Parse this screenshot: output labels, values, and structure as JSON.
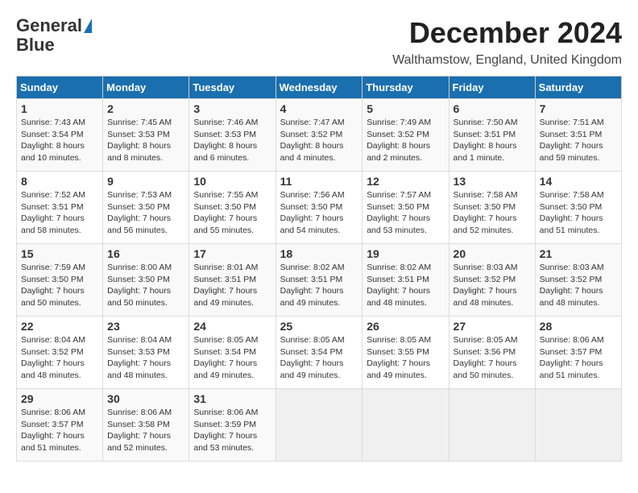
{
  "logo": {
    "line1": "General",
    "line2": "Blue"
  },
  "title": "December 2024",
  "subtitle": "Walthamstow, England, United Kingdom",
  "days_header": [
    "Sunday",
    "Monday",
    "Tuesday",
    "Wednesday",
    "Thursday",
    "Friday",
    "Saturday"
  ],
  "weeks": [
    [
      {
        "day": "1",
        "sunrise": "7:43 AM",
        "sunset": "3:54 PM",
        "daylight": "8 hours and 10 minutes."
      },
      {
        "day": "2",
        "sunrise": "7:45 AM",
        "sunset": "3:53 PM",
        "daylight": "8 hours and 8 minutes."
      },
      {
        "day": "3",
        "sunrise": "7:46 AM",
        "sunset": "3:53 PM",
        "daylight": "8 hours and 6 minutes."
      },
      {
        "day": "4",
        "sunrise": "7:47 AM",
        "sunset": "3:52 PM",
        "daylight": "8 hours and 4 minutes."
      },
      {
        "day": "5",
        "sunrise": "7:49 AM",
        "sunset": "3:52 PM",
        "daylight": "8 hours and 2 minutes."
      },
      {
        "day": "6",
        "sunrise": "7:50 AM",
        "sunset": "3:51 PM",
        "daylight": "8 hours and 1 minute."
      },
      {
        "day": "7",
        "sunrise": "7:51 AM",
        "sunset": "3:51 PM",
        "daylight": "7 hours and 59 minutes."
      }
    ],
    [
      {
        "day": "8",
        "sunrise": "7:52 AM",
        "sunset": "3:51 PM",
        "daylight": "7 hours and 58 minutes."
      },
      {
        "day": "9",
        "sunrise": "7:53 AM",
        "sunset": "3:50 PM",
        "daylight": "7 hours and 56 minutes."
      },
      {
        "day": "10",
        "sunrise": "7:55 AM",
        "sunset": "3:50 PM",
        "daylight": "7 hours and 55 minutes."
      },
      {
        "day": "11",
        "sunrise": "7:56 AM",
        "sunset": "3:50 PM",
        "daylight": "7 hours and 54 minutes."
      },
      {
        "day": "12",
        "sunrise": "7:57 AM",
        "sunset": "3:50 PM",
        "daylight": "7 hours and 53 minutes."
      },
      {
        "day": "13",
        "sunrise": "7:58 AM",
        "sunset": "3:50 PM",
        "daylight": "7 hours and 52 minutes."
      },
      {
        "day": "14",
        "sunrise": "7:58 AM",
        "sunset": "3:50 PM",
        "daylight": "7 hours and 51 minutes."
      }
    ],
    [
      {
        "day": "15",
        "sunrise": "7:59 AM",
        "sunset": "3:50 PM",
        "daylight": "7 hours and 50 minutes."
      },
      {
        "day": "16",
        "sunrise": "8:00 AM",
        "sunset": "3:50 PM",
        "daylight": "7 hours and 50 minutes."
      },
      {
        "day": "17",
        "sunrise": "8:01 AM",
        "sunset": "3:51 PM",
        "daylight": "7 hours and 49 minutes."
      },
      {
        "day": "18",
        "sunrise": "8:02 AM",
        "sunset": "3:51 PM",
        "daylight": "7 hours and 49 minutes."
      },
      {
        "day": "19",
        "sunrise": "8:02 AM",
        "sunset": "3:51 PM",
        "daylight": "7 hours and 48 minutes."
      },
      {
        "day": "20",
        "sunrise": "8:03 AM",
        "sunset": "3:52 PM",
        "daylight": "7 hours and 48 minutes."
      },
      {
        "day": "21",
        "sunrise": "8:03 AM",
        "sunset": "3:52 PM",
        "daylight": "7 hours and 48 minutes."
      }
    ],
    [
      {
        "day": "22",
        "sunrise": "8:04 AM",
        "sunset": "3:52 PM",
        "daylight": "7 hours and 48 minutes."
      },
      {
        "day": "23",
        "sunrise": "8:04 AM",
        "sunset": "3:53 PM",
        "daylight": "7 hours and 48 minutes."
      },
      {
        "day": "24",
        "sunrise": "8:05 AM",
        "sunset": "3:54 PM",
        "daylight": "7 hours and 49 minutes."
      },
      {
        "day": "25",
        "sunrise": "8:05 AM",
        "sunset": "3:54 PM",
        "daylight": "7 hours and 49 minutes."
      },
      {
        "day": "26",
        "sunrise": "8:05 AM",
        "sunset": "3:55 PM",
        "daylight": "7 hours and 49 minutes."
      },
      {
        "day": "27",
        "sunrise": "8:05 AM",
        "sunset": "3:56 PM",
        "daylight": "7 hours and 50 minutes."
      },
      {
        "day": "28",
        "sunrise": "8:06 AM",
        "sunset": "3:57 PM",
        "daylight": "7 hours and 51 minutes."
      }
    ],
    [
      {
        "day": "29",
        "sunrise": "8:06 AM",
        "sunset": "3:57 PM",
        "daylight": "7 hours and 51 minutes."
      },
      {
        "day": "30",
        "sunrise": "8:06 AM",
        "sunset": "3:58 PM",
        "daylight": "7 hours and 52 minutes."
      },
      {
        "day": "31",
        "sunrise": "8:06 AM",
        "sunset": "3:59 PM",
        "daylight": "7 hours and 53 minutes."
      },
      null,
      null,
      null,
      null
    ]
  ],
  "labels": {
    "sunrise": "Sunrise:",
    "sunset": "Sunset:",
    "daylight": "Daylight:"
  }
}
